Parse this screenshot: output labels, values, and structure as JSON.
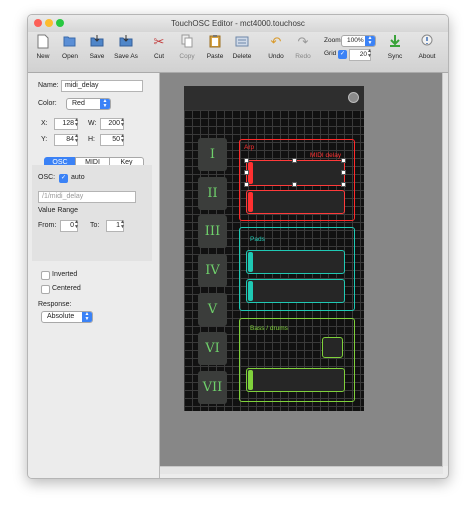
{
  "window": {
    "title": "TouchOSC Editor - mct4000.touchosc"
  },
  "toolbar": {
    "new": "New",
    "open": "Open",
    "save": "Save",
    "save_as": "Save As",
    "cut": "Cut",
    "copy": "Copy",
    "paste": "Paste",
    "delete": "Delete",
    "undo": "Undo",
    "redo": "Redo",
    "zoom_label": "Zoom",
    "zoom_value": "100%",
    "grid_label": "Grid",
    "grid_value": "20",
    "sync": "Sync",
    "about": "About"
  },
  "properties": {
    "name_label": "Name:",
    "name_value": "midi_delay",
    "color_label": "Color:",
    "color_value": "Red",
    "x_label": "X:",
    "x_value": "128",
    "w_label": "W:",
    "w_value": "200",
    "y_label": "Y:",
    "y_value": "84",
    "h_label": "H:",
    "h_value": "50",
    "tabs": [
      "OSC",
      "MIDI",
      "Key"
    ],
    "osc_label": "OSC:",
    "auto_label": "auto",
    "osc_address": "/1/midi_delay",
    "value_range": "Value Range",
    "from_label": "From:",
    "from_value": "0",
    "to_label": "To:",
    "to_value": "1",
    "inverted": "Inverted",
    "centered": "Centered",
    "response_label": "Response:",
    "response_value": "Absolute"
  },
  "layout": {
    "pages": [
      "I",
      "II",
      "III",
      "IV",
      "V",
      "VI",
      "VII"
    ],
    "groups": {
      "arp": "Arp",
      "midi_delay": "MIDI delay",
      "pads": "Pads",
      "bass": "Bass / drums"
    }
  },
  "colors": {
    "red": "#ff2a2a",
    "teal": "#1fc9b4",
    "green": "#7fd13b",
    "accent": "#3b82f6"
  },
  "icons": [
    "new-icon",
    "open-icon",
    "save-icon",
    "save-as-icon",
    "cut-icon",
    "copy-icon",
    "paste-icon",
    "delete-icon",
    "undo-icon",
    "redo-icon",
    "sync-icon",
    "about-icon"
  ]
}
